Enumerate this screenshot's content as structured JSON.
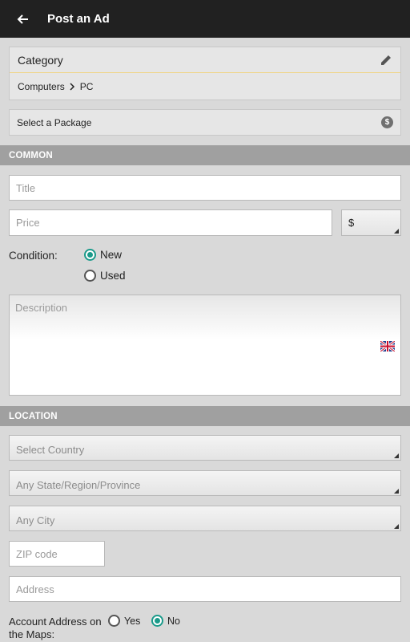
{
  "appbar": {
    "title": "Post an Ad"
  },
  "category": {
    "label": "Category",
    "path": [
      "Computers",
      "PC"
    ]
  },
  "package": {
    "label": "Select a Package"
  },
  "sections": {
    "common": "COMMON",
    "location": "LOCATION"
  },
  "form": {
    "title_placeholder": "Title",
    "price_placeholder": "Price",
    "currency": "$",
    "condition_label": "Condition:",
    "condition_options": [
      {
        "label": "New",
        "selected": true
      },
      {
        "label": "Used",
        "selected": false
      }
    ],
    "description_placeholder": "Description"
  },
  "location": {
    "country": "Select Country",
    "state": "Any State/Region/Province",
    "city": "Any City",
    "zip_placeholder": "ZIP code",
    "address_placeholder": "Address",
    "account_address_label": "Account Address on the Maps:",
    "account_address_options": [
      {
        "label": "Yes",
        "selected": false
      },
      {
        "label": "No",
        "selected": true
      }
    ]
  },
  "colors": {
    "accent": "#1a9a8a",
    "appbar": "#212121",
    "section": "#a0a0a0"
  }
}
